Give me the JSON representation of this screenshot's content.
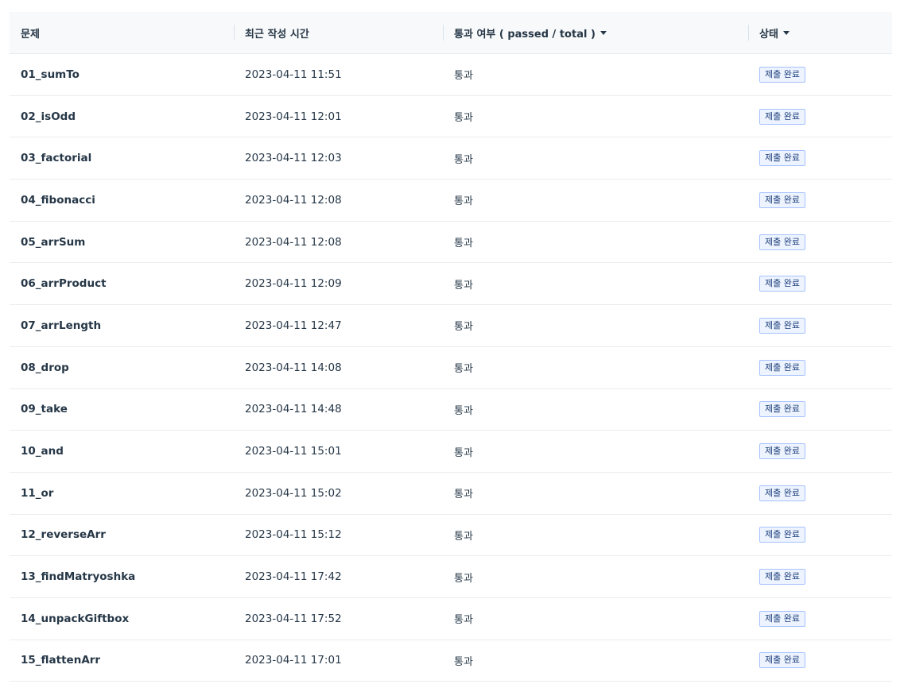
{
  "header": {
    "problem": "문제",
    "time": "최근 작성 시간",
    "pass": "통과 여부 ( passed / total )",
    "status": "상태"
  },
  "rows": [
    {
      "problem": "01_sumTo",
      "time": "2023-04-11 11:51",
      "pass": "통과",
      "status": "제출 완료"
    },
    {
      "problem": "02_isOdd",
      "time": "2023-04-11 12:01",
      "pass": "통과",
      "status": "제출 완료"
    },
    {
      "problem": "03_factorial",
      "time": "2023-04-11 12:03",
      "pass": "통과",
      "status": "제출 완료"
    },
    {
      "problem": "04_fibonacci",
      "time": "2023-04-11 12:08",
      "pass": "통과",
      "status": "제출 완료"
    },
    {
      "problem": "05_arrSum",
      "time": "2023-04-11 12:08",
      "pass": "통과",
      "status": "제출 완료"
    },
    {
      "problem": "06_arrProduct",
      "time": "2023-04-11 12:09",
      "pass": "통과",
      "status": "제출 완료"
    },
    {
      "problem": "07_arrLength",
      "time": "2023-04-11 12:47",
      "pass": "통과",
      "status": "제출 완료"
    },
    {
      "problem": "08_drop",
      "time": "2023-04-11 14:08",
      "pass": "통과",
      "status": "제출 완료"
    },
    {
      "problem": "09_take",
      "time": "2023-04-11 14:48",
      "pass": "통과",
      "status": "제출 완료"
    },
    {
      "problem": "10_and",
      "time": "2023-04-11 15:01",
      "pass": "통과",
      "status": "제출 완료"
    },
    {
      "problem": "11_or",
      "time": "2023-04-11 15:02",
      "pass": "통과",
      "status": "제출 완료"
    },
    {
      "problem": "12_reverseArr",
      "time": "2023-04-11 15:12",
      "pass": "통과",
      "status": "제출 완료"
    },
    {
      "problem": "13_findMatryoshka",
      "time": "2023-04-11 17:42",
      "pass": "통과",
      "status": "제출 완료"
    },
    {
      "problem": "14_unpackGiftbox",
      "time": "2023-04-11 17:52",
      "pass": "통과",
      "status": "제출 완료"
    },
    {
      "problem": "15_flattenArr",
      "time": "2023-04-11 17:01",
      "pass": "통과",
      "status": "제출 완료"
    }
  ],
  "colors": {
    "header_bg": "#f8f9fa",
    "row_border": "#e9ecef",
    "badge_border": "#a6c2ff",
    "badge_bg": "#eef4ff",
    "text": "#263747"
  }
}
